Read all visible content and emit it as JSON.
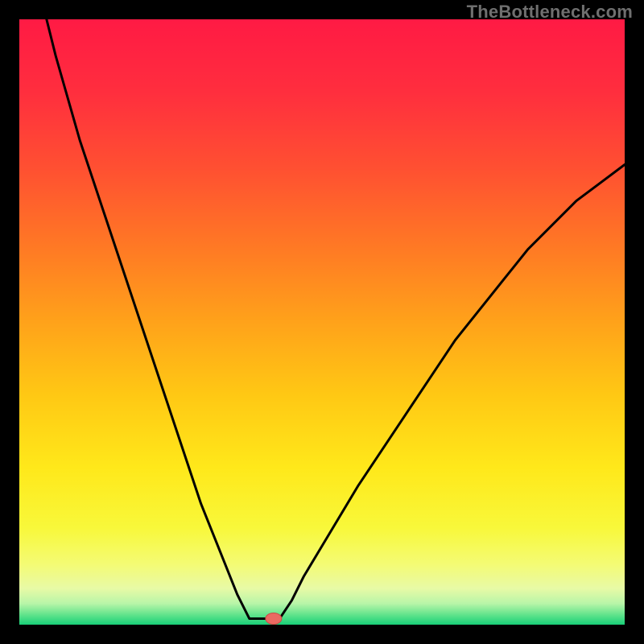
{
  "watermark": "TheBottleneck.com",
  "colors": {
    "marker_fill": "#ea6a62",
    "marker_stroke": "#cc4b45"
  },
  "gradient_stops": [
    {
      "offset": 0.0,
      "color": "#ff1a44"
    },
    {
      "offset": 0.12,
      "color": "#ff2e3e"
    },
    {
      "offset": 0.25,
      "color": "#ff5131"
    },
    {
      "offset": 0.38,
      "color": "#ff7a24"
    },
    {
      "offset": 0.5,
      "color": "#ffa21a"
    },
    {
      "offset": 0.62,
      "color": "#ffc814"
    },
    {
      "offset": 0.74,
      "color": "#ffe81a"
    },
    {
      "offset": 0.84,
      "color": "#f8f83a"
    },
    {
      "offset": 0.9,
      "color": "#f4fb74"
    },
    {
      "offset": 0.94,
      "color": "#e8faa6"
    },
    {
      "offset": 0.965,
      "color": "#b8f5a8"
    },
    {
      "offset": 0.985,
      "color": "#5be28a"
    },
    {
      "offset": 1.0,
      "color": "#18cf78"
    }
  ],
  "chart_data": {
    "type": "line",
    "title": "",
    "xlabel": "",
    "ylabel": "",
    "xlim": [
      0,
      100
    ],
    "ylim": [
      0,
      100
    ],
    "grid": false,
    "legend": false,
    "optimal_x": 42,
    "flat_bottom_start_x": 38,
    "flat_bottom_end_x": 43,
    "marker": {
      "x": 42,
      "y": 1.0
    },
    "series": [
      {
        "name": "bottleneck",
        "x": [
          0,
          2,
          4,
          6,
          8,
          10,
          12,
          14,
          16,
          18,
          20,
          22,
          24,
          26,
          28,
          30,
          32,
          34,
          36,
          38,
          40,
          42,
          43,
          45,
          47,
          50,
          53,
          56,
          60,
          64,
          68,
          72,
          76,
          80,
          84,
          88,
          92,
          96,
          100
        ],
        "y": [
          130,
          112,
          102,
          94,
          87,
          80,
          74,
          68,
          62,
          56,
          50,
          44,
          38,
          32,
          26,
          20,
          15,
          10,
          5,
          1,
          1,
          1,
          1,
          4,
          8,
          13,
          18,
          23,
          29,
          35,
          41,
          47,
          52,
          57,
          62,
          66,
          70,
          73,
          76
        ]
      }
    ]
  }
}
